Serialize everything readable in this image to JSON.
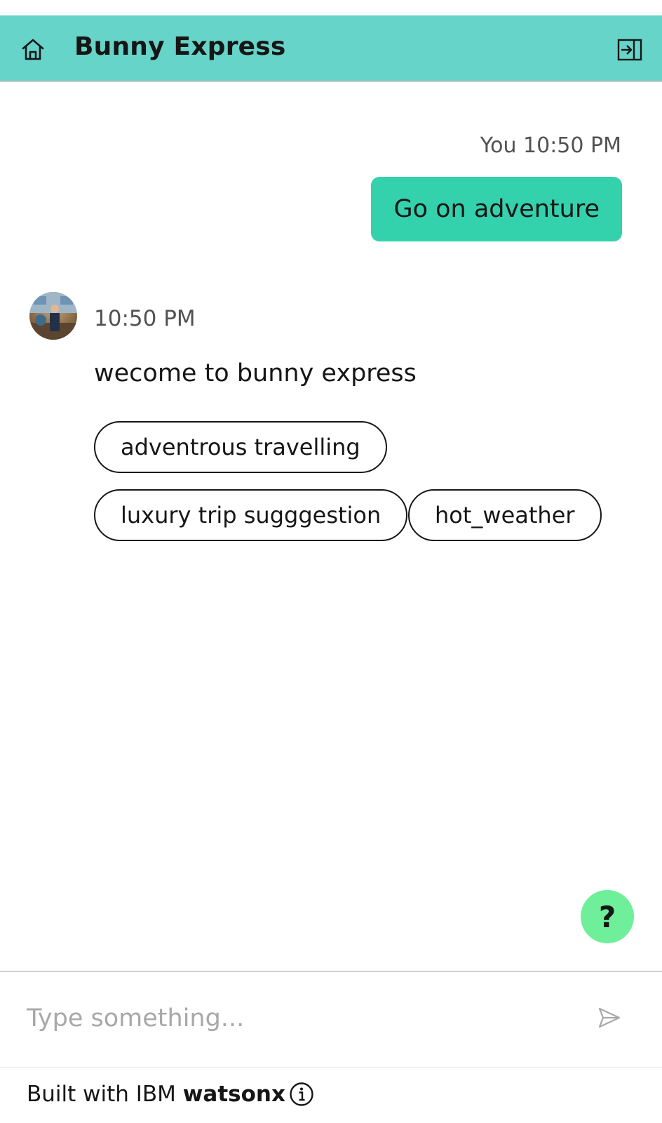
{
  "header": {
    "title": "Bunny Express",
    "home_icon": "home-icon",
    "collapse_icon": "panel-collapse-icon",
    "background": "#66d4c8"
  },
  "conversation": {
    "user_message": {
      "sender": "You",
      "time": "10:50 PM",
      "meta": "You 10:50 PM",
      "text": "Go on adventure",
      "bubble_color": "#34d1ad"
    },
    "bot_message": {
      "time": "10:50 PM",
      "text": "wecome to bunny express",
      "options": [
        "adventrous travelling",
        "luxury trip sugggestion",
        "hot_weather"
      ]
    }
  },
  "help_button": {
    "label": "?",
    "color": "#6fef9a"
  },
  "input": {
    "placeholder": "Type something...",
    "send_icon": "send-icon"
  },
  "footer": {
    "prefix": "Built with IBM ",
    "brand": "watsonx",
    "info_icon": "info-icon"
  }
}
